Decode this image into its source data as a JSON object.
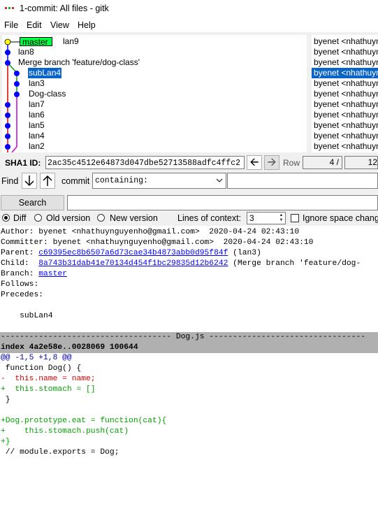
{
  "window": {
    "title": "1-commit: All files - gitk"
  },
  "menu": [
    "File",
    "Edit",
    "View",
    "Help"
  ],
  "colors": {
    "selection": "#0a64c8",
    "branch_tag": "#00ff40",
    "file_header": "#b0b0b0",
    "removed": "#d40000",
    "added": "#00a000"
  },
  "commits": [
    {
      "label": "master",
      "label2": "lan9",
      "author": "byenet <nhathuyn"
    },
    {
      "label": "lan8",
      "author": "byenet <nhathuyn"
    },
    {
      "label": "Merge branch 'feature/dog-class'",
      "author": "byenet <nhathuyn"
    },
    {
      "label": "subLan4",
      "author": "byenet <nhathuyn",
      "selected": true
    },
    {
      "label": "lan3",
      "author": "byenet <nhathuyn"
    },
    {
      "label": "Dog-class",
      "author": "byenet <nhathuyn"
    },
    {
      "label": "lan7",
      "author": "byenet <nhathuyn"
    },
    {
      "label": "lan6",
      "author": "byenet <nhathuyn"
    },
    {
      "label": "lan5",
      "author": "byenet <nhathuyn"
    },
    {
      "label": "lan4",
      "author": "byenet <nhathuyn"
    },
    {
      "label": "lan2",
      "author": "byenet <nhathuyn"
    }
  ],
  "sha": {
    "label": "SHA1 ID:",
    "value": "2ac35c4512e64873d047dbe52713588adfc4ffc2",
    "row_label": "Row",
    "row_value": "4 /",
    "row_total": "12"
  },
  "find": {
    "label": "Find",
    "commit_label": "commit",
    "mode": "containing:"
  },
  "search": {
    "button": "Search"
  },
  "diff_options": {
    "diff": "Diff",
    "old_version": "Old version",
    "new_version": "New version",
    "context_label": "Lines of context:",
    "context_value": "3",
    "ignore_space": "Ignore space chang"
  },
  "details": {
    "author": "Author: byenet <nhathuynguyenho@gmail.com>  2020-04-24 02:43:10",
    "committer": "Committer: byenet <nhathuynguyenho@gmail.com>  2020-04-24 02:43:10",
    "parent_prefix": "Parent: ",
    "parent_sha": "c69395ec8b6507a6d73cae34b4873abb0d95f84f",
    "parent_suffix": " (lan3)",
    "child_prefix": "Child:  ",
    "child_sha": "8a743b31dab41e70134d454f1bc29835d12b6242",
    "child_suffix": " (Merge branch 'feature/dog-",
    "branch_prefix": "Branch: ",
    "branch": "master",
    "follows": "Follows:",
    "precedes": "Precedes:",
    "message": "    subLan4"
  },
  "diff": {
    "file_header": "------------------------------------ Dog.js ---------------------------------",
    "index_line": "index 4a2e58e..0028069 100644",
    "hunk": "@@ -1,5 +1,8 @@",
    "lines": [
      " function Dog() {",
      "-  this.name = name;",
      "+  this.stomach = []",
      " }",
      "",
      "+Dog.prototype.eat = function(cat){",
      "+    this.stomach.push(cat)",
      "+}",
      " // module.exports = Dog;"
    ]
  }
}
